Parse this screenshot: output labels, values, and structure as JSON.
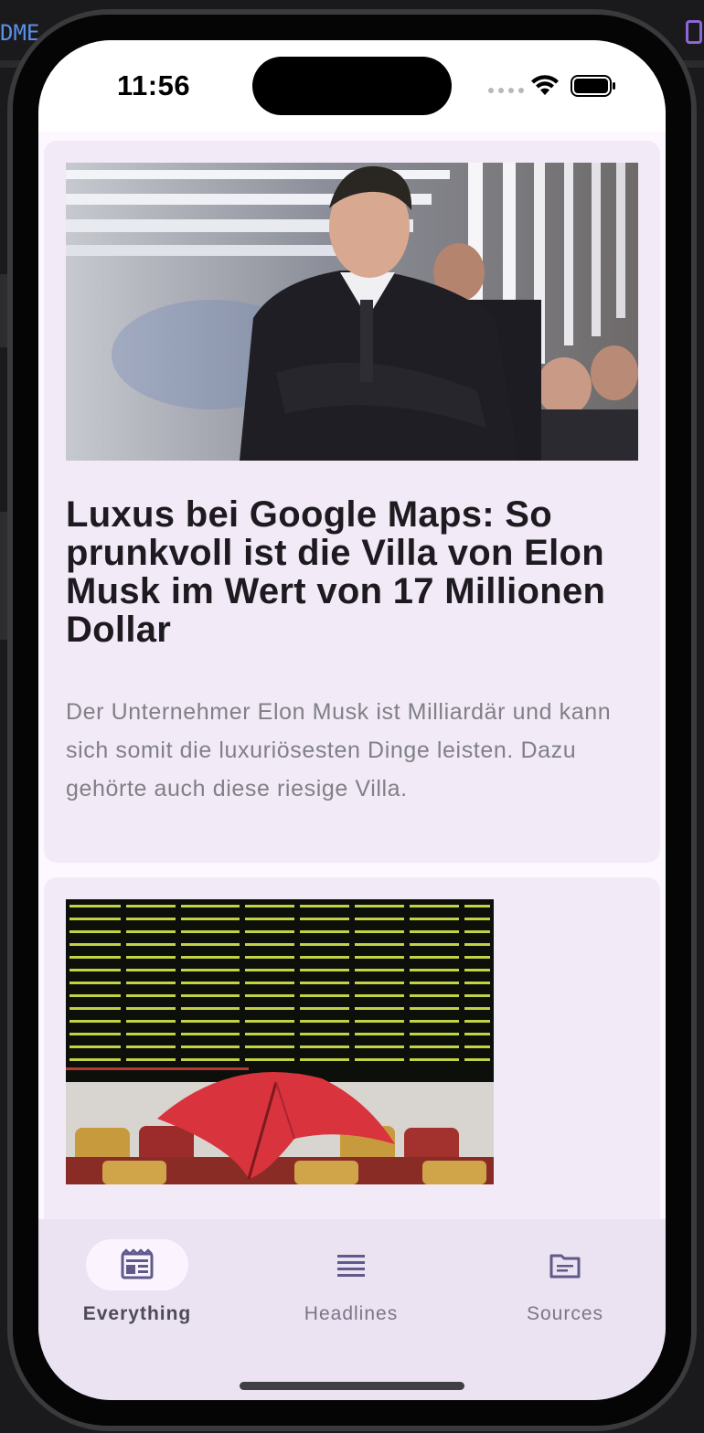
{
  "status_bar": {
    "time": "11:56"
  },
  "background": {
    "editor_fragment": "DME"
  },
  "articles": [
    {
      "title": "Luxus bei Google Maps: So prunkvoll ist die Villa von Elon Musk im Wert von 17 Millionen Dollar",
      "description": "Der Unternehmer Elon Musk ist Milliardär und kann sich somit die luxuriösesten Dinge leisten. Dazu gehörte auch diese riesige Villa.",
      "image_icon": "photo-man-crossed-arms"
    },
    {
      "title": "",
      "description": "",
      "image_icon": "photo-stock-board-red-umbrella"
    }
  ],
  "bottom_nav": {
    "items": [
      {
        "label": "Everything",
        "icon": "newspaper-icon",
        "active": true
      },
      {
        "label": "Headlines",
        "icon": "list-icon",
        "active": false
      },
      {
        "label": "Sources",
        "icon": "folder-icon",
        "active": false
      }
    ]
  },
  "colors": {
    "card_background": "#f2eaf7",
    "nav_background": "#ece3f2",
    "nav_active_pill": "#fbf4ff",
    "title_text": "#1d1b20",
    "description_text": "#808086",
    "nav_icon": "#5f5a8a"
  }
}
